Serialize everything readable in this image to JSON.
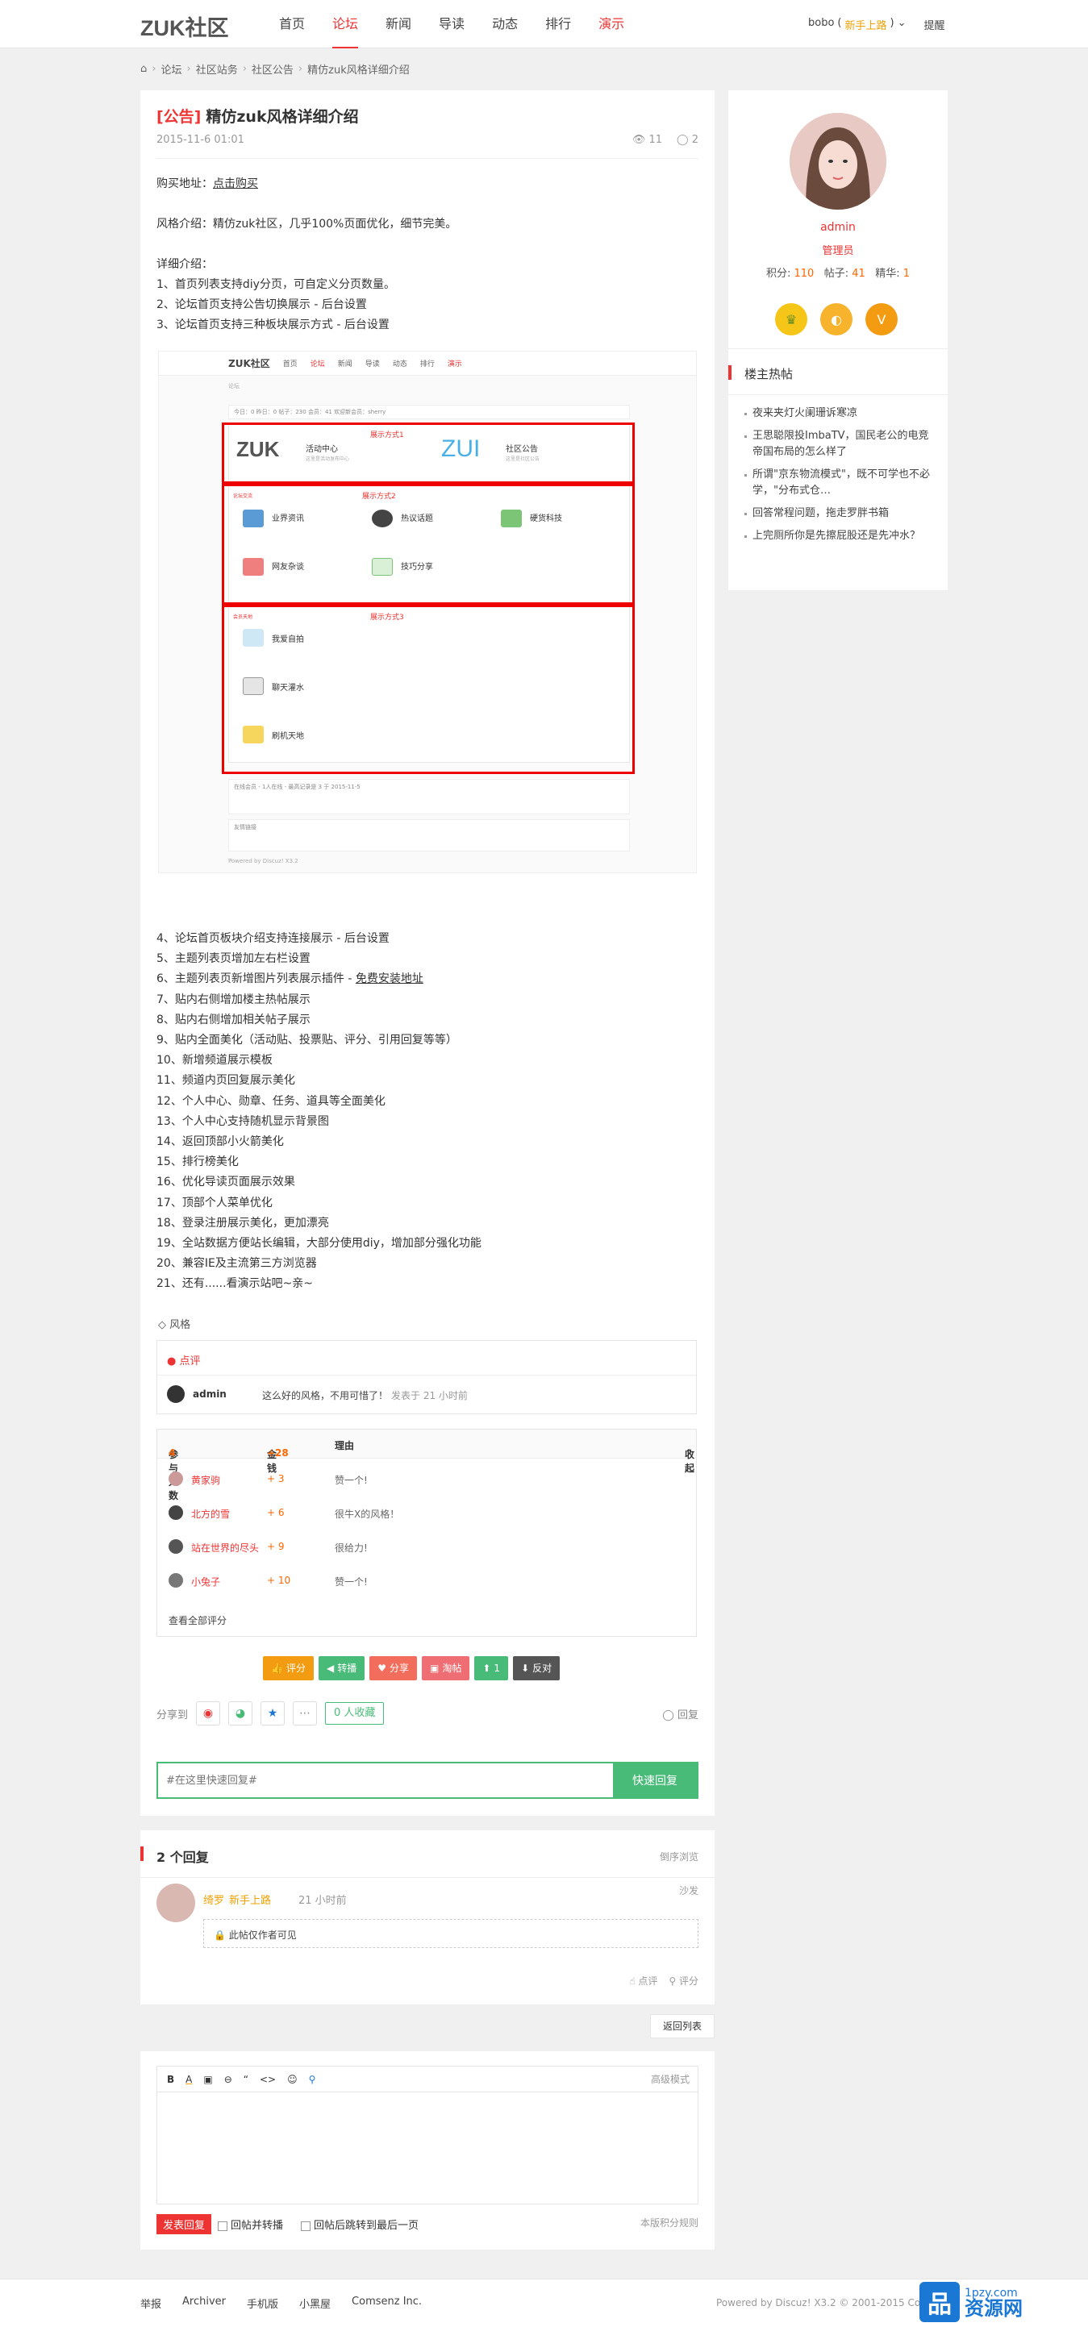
{
  "header": {
    "logo": "ZUK社区",
    "nav": [
      "首页",
      "论坛",
      "新闻",
      "导读",
      "动态",
      "排行",
      "演示"
    ],
    "user": {
      "name": "bobo",
      "group": "新手上路",
      "remind": "提醒"
    }
  },
  "breadcrumb": [
    "论坛",
    "社区站务",
    "社区公告",
    "精仿zuk风格详细介绍"
  ],
  "post": {
    "tag": "[公告]",
    "title": "精仿zuk风格详细介绍",
    "date": "2015-11-6 01:01",
    "views": "11",
    "replies": "2",
    "buy_label": "购买地址：",
    "buy_link": "点击购买",
    "intro": "风格介绍：精仿zuk社区，几乎100%页面优化，细节完美。",
    "detail_title": "详细介绍：",
    "items_top": [
      "1、首页列表支持diy分页，可自定义分页数量。",
      "2、论坛首页支持公告切换展示 - 后台设置",
      "3、论坛首页支持三种板块展示方式 - 后台设置"
    ],
    "items_bottom": [
      "4、论坛首页板块介绍支持连接展示 - 后台设置",
      "5、主题列表页增加左右栏设置",
      "7、贴内右侧增加楼主热帖展示",
      "8、贴内右侧增加相关帖子展示",
      "9、贴内全面美化（活动贴、投票贴、评分、引用回复等等）",
      "10、新增频道展示模板",
      "11、频道内页回复展示美化",
      "12、个人中心、勋章、任务、道具等全面美化",
      "13、个人中心支持随机显示背景图",
      "14、返回顶部小火箭美化",
      "15、排行榜美化",
      "16、优化导读页面展示效果",
      "17、顶部个人菜单优化",
      "18、登录注册展示美化，更加漂亮",
      "19、全站数据方便站长编辑，大部分使用diy，增加部分强化功能",
      "20、兼容IE及主流第三方浏览器",
      "21、还有......看演示站吧~亲~"
    ],
    "item6_prefix": "6、主题列表页新增图片列表展示插件 - ",
    "item6_link": "免费安装地址",
    "tag_label": "风格"
  },
  "screenshot": {
    "logo": "ZUK社区",
    "nav": [
      "首页",
      "论坛",
      "新闻",
      "导读",
      "动态",
      "排行",
      "演示"
    ],
    "crumb": "论坛",
    "stats": "今日：0  昨日：0  帖子：230  会员：41  欢迎新会员：sherry",
    "label1": "展示方式1",
    "label2": "展示方式2",
    "label3": "展示方式3",
    "c1_title": "活动中心",
    "c1_sub": "这里是活动发布中心",
    "c2_title": "社区公告",
    "c2_sub": "这里是社区公告",
    "g_title": "论坛交流",
    "g_items": [
      "业界资讯",
      "热议话题",
      "硬货科技",
      "网友杂谈",
      "技巧分享"
    ],
    "h_title": "会员天地",
    "h_items": [
      "我爱自拍",
      "聊天灌水",
      "刷机天地"
    ],
    "foot1": "在线会员 - 1人在线 - 最高记录是 3 于 2015-11-5",
    "foot2": "友情链接",
    "bottom": "Powered by Discuz! X3.2"
  },
  "comment": {
    "title": "点评",
    "user": "admin",
    "text": "这么好的风格，不用可惜了！",
    "time": "发表于 21 小时前"
  },
  "rating": {
    "participants_label": "参与人数",
    "participants": "4",
    "money_label": "金钱",
    "money": "+28",
    "reason_label": "理由",
    "collapse": "收起",
    "rows": [
      {
        "name": "黄家驹",
        "score": "+ 3",
        "reason": "赞一个!"
      },
      {
        "name": "北方的雪",
        "score": "+ 6",
        "reason": "很牛X的风格！"
      },
      {
        "name": "站在世界的尽头",
        "score": "+ 9",
        "reason": "很给力!"
      },
      {
        "name": "小兔子",
        "score": "+ 10",
        "reason": "赞一个!"
      }
    ],
    "view_all": "查看全部评分"
  },
  "actions": [
    {
      "label": "评分",
      "color": "#f39c12",
      "icon": "thumb-icon"
    },
    {
      "label": "转播",
      "color": "#48bb78",
      "icon": "megaphone-icon"
    },
    {
      "label": "分享",
      "color": "#f26d5b",
      "icon": "heart-icon"
    },
    {
      "label": "淘帖",
      "color": "#ee6e73",
      "icon": "bag-icon"
    },
    {
      "label": "支持",
      "value": "1",
      "color": "#48bb78",
      "icon": "up-icon"
    },
    {
      "label": "反对",
      "color": "#555555",
      "icon": "down-icon"
    }
  ],
  "share": {
    "label": "分享到",
    "favorite": "0 人收藏",
    "reply": "回复"
  },
  "quick_reply": {
    "placeholder": "#在这里快速回复#",
    "button": "快速回复"
  },
  "replies": {
    "title": "2 个回复",
    "order": "倒序浏览",
    "user": "绮罗",
    "group": "新手上路",
    "time": "21 小时前",
    "floor": "沙发",
    "hidden": "此帖仅作者可见",
    "like": "点评",
    "rate": "评分"
  },
  "back_list": "返回列表",
  "editor": {
    "tools": [
      "B",
      "A",
      "▣",
      "⊖",
      "“",
      "<>",
      "☺",
      "⚲"
    ],
    "advanced": "高级模式",
    "submit": "发表回复",
    "opt1": "回帖并转播",
    "opt2": "回帖后跳转到最后一页",
    "rule": "本版积分规则"
  },
  "footer": {
    "links": [
      "举报",
      "Archiver",
      "手机版",
      "小黑屋",
      "Comsenz Inc."
    ],
    "copyright": "Powered by Discuz! X3.2 © 2001-2015 Comsenz"
  },
  "watermark": {
    "url": "1pzy.com",
    "name": "资源网"
  },
  "sidebar": {
    "name": "admin",
    "role": "管理员",
    "points_label": "积分:",
    "points": "110",
    "posts_label": "帖子:",
    "posts": "41",
    "digest_label": "精华:",
    "digest": "1",
    "hot_title": "楼主热帖",
    "hot": [
      "夜来夹灯火阑珊诉寒凉",
      "王思聪限投ImbaTV，国民老公的电竞帝国布局的怎么样了",
      "所谓\"京东物流模式\"，既不可学也不必学，\"分布式仓…",
      "回答常程问题，拖走罗胖书箱",
      "上完厕所你是先擦屁股还是先冲水？"
    ]
  }
}
